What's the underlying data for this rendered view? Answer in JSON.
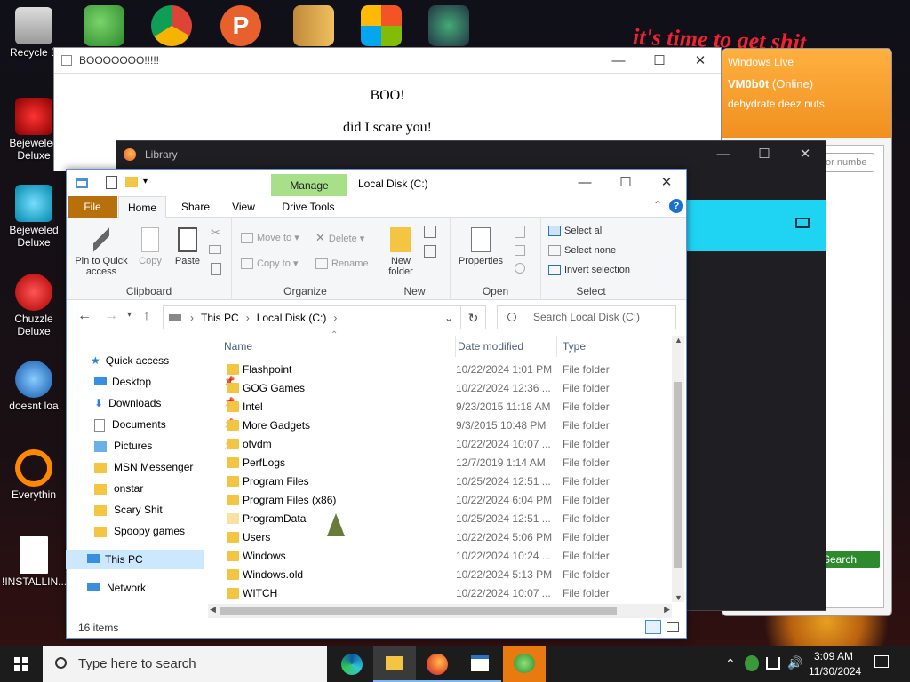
{
  "desktop": {
    "icons": [
      {
        "label": "Recycle B"
      },
      {
        "label": "Bejeweled Deluxe"
      },
      {
        "label": "Bejeweled Deluxe"
      },
      {
        "label": "Chuzzle Deluxe"
      },
      {
        "label": "doesnt loa"
      },
      {
        "label": "Everythin"
      },
      {
        "label": "!INSTALLIN..."
      }
    ],
    "wallpaper_text": "it's time to get shit"
  },
  "msn": {
    "title": "Windows Live",
    "name": "VM0b0t",
    "status": "(Online)",
    "personal": "dehydrate deez nuts",
    "search_placeholder": "or numbe",
    "search_button": "Search"
  },
  "boo": {
    "title": "BOOOOOOO!!!!!",
    "line1": "BOO!",
    "line2": "did I scare you!"
  },
  "library": {
    "title": "Library"
  },
  "explorer": {
    "title": "Local Disk (C:)",
    "manage_tab": "Manage",
    "tabs": [
      "File",
      "Home",
      "Share",
      "View",
      "Drive Tools"
    ],
    "ribbon": {
      "clipboard": {
        "label": "Clipboard",
        "pin": "Pin to Quick access",
        "copy": "Copy",
        "paste": "Paste"
      },
      "organize": {
        "label": "Organize",
        "move_to": "Move to",
        "copy_to": "Copy to",
        "delete": "Delete",
        "rename": "Rename"
      },
      "new": {
        "label": "New",
        "new_folder": "New folder"
      },
      "open": {
        "label": "Open",
        "properties": "Properties"
      },
      "select": {
        "label": "Select",
        "select_all": "Select all",
        "select_none": "Select none",
        "invert": "Invert selection"
      }
    },
    "address": {
      "this_pc": "This PC",
      "disk": "Local Disk (C:)",
      "search_placeholder": "Search Local Disk (C:)"
    },
    "nav": {
      "quick_access": "Quick access",
      "items": [
        {
          "label": "Desktop",
          "pinned": true
        },
        {
          "label": "Downloads",
          "pinned": true
        },
        {
          "label": "Documents",
          "pinned": true
        },
        {
          "label": "Pictures",
          "pinned": true
        },
        {
          "label": "MSN Messenger",
          "pinned": false
        },
        {
          "label": "onstar",
          "pinned": false
        },
        {
          "label": "Scary Shit",
          "pinned": false
        },
        {
          "label": "Spoopy games",
          "pinned": false
        }
      ],
      "this_pc": "This PC",
      "network": "Network"
    },
    "columns": {
      "name": "Name",
      "date": "Date modified",
      "type": "Type"
    },
    "files": [
      {
        "name": "Flashpoint",
        "date": "10/22/2024 1:01 PM",
        "type": "File folder"
      },
      {
        "name": "GOG Games",
        "date": "10/22/2024 12:36 ...",
        "type": "File folder"
      },
      {
        "name": "Intel",
        "date": "9/23/2015 11:18 AM",
        "type": "File folder"
      },
      {
        "name": "More Gadgets",
        "date": "9/3/2015 10:48 PM",
        "type": "File folder"
      },
      {
        "name": "otvdm",
        "date": "10/22/2024 10:07 ...",
        "type": "File folder"
      },
      {
        "name": "PerfLogs",
        "date": "12/7/2019 1:14 AM",
        "type": "File folder"
      },
      {
        "name": "Program Files",
        "date": "10/25/2024 12:51 ...",
        "type": "File folder"
      },
      {
        "name": "Program Files (x86)",
        "date": "10/22/2024 6:04 PM",
        "type": "File folder"
      },
      {
        "name": "ProgramData",
        "date": "10/25/2024 12:51 ...",
        "type": "File folder"
      },
      {
        "name": "Users",
        "date": "10/22/2024 5:06 PM",
        "type": "File folder"
      },
      {
        "name": "Windows",
        "date": "10/22/2024 10:24 ...",
        "type": "File folder"
      },
      {
        "name": "Windows.old",
        "date": "10/22/2024 5:13 PM",
        "type": "File folder"
      },
      {
        "name": "WITCH",
        "date": "10/22/2024 10:07 ...",
        "type": "File folder"
      }
    ],
    "status": "16 items"
  },
  "taskbar": {
    "search": "Type here to search",
    "time": "3:09 AM",
    "date": "11/30/2024"
  },
  "colors": {
    "file_tab": "#b8700c",
    "manage_tab": "#a8e08a",
    "folder": "#f4c542",
    "cyan": "#1fd3f3",
    "msn": "#f09020"
  }
}
